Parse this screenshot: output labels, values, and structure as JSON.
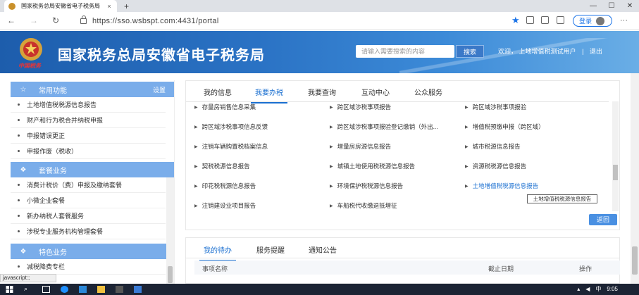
{
  "browser": {
    "tab_title": "国家税务总局安徽省电子税务局",
    "tab_close": "×",
    "new_tab": "+",
    "url": "https://sso.wsbspt.com:4431/portal",
    "login_label": "登录",
    "win_min": "—",
    "win_max": "☐",
    "win_close": "✕"
  },
  "header": {
    "title": "国家税务总局安徽省电子税务局",
    "emblem_caption": "中国税务",
    "search_placeholder": "请输入需要搜索的内容",
    "search_button": "搜索",
    "welcome": "欢迎，",
    "user": "上地增值税测试用户",
    "logout": "退出"
  },
  "sidebar": {
    "section_common": "常用功能",
    "settings": "设置",
    "common_items": [
      "土地增值税税源信息报告",
      "财产和行为税合并纳税申报",
      "申报错误更正",
      "申报作废（税收）"
    ],
    "section_package": "套餐业务",
    "package_items": [
      "消费计税价（费）申报及缴纳套餐",
      "小微企业套餐",
      "新办纳税人套餐服务",
      "涉税专业服务机构管理套餐"
    ],
    "section_special": "特色业务",
    "special_items": [
      "减税降费专栏"
    ]
  },
  "main": {
    "tabs": [
      "我的信息",
      "我要办税",
      "我要查询",
      "互动中心",
      "公众服务"
    ],
    "active_tab": "我要办税",
    "grid": [
      [
        "存量房销售信息采集",
        "跨区域涉税事项报告",
        "跨区域涉税事项报验"
      ],
      [
        "跨区域涉税事项信息反馈",
        "跨区域涉税事项报验登记缴销（外出...",
        "增值税预缴申报（跨区域）"
      ],
      [
        "注销车辆购置税档案信息",
        "增量房房源信息报告",
        "城市税源信息报告"
      ],
      [
        "契税税源信息报告",
        "城镇土地使用税税源信息报告",
        "资源税税源信息报告"
      ],
      [
        "印花税税源信息报告",
        "环境保护税税源信息报告",
        "土地增值税税源信息报告"
      ],
      [
        "注销建设业项目报告",
        "车船税代收缴退抵增征",
        ""
      ]
    ],
    "tooltip": "土地增值税税源信息报告",
    "back_button": "返回"
  },
  "todo": {
    "tabs": [
      "我的待办",
      "服务提醒",
      "通知公告"
    ],
    "active_tab": "我的待办",
    "columns": [
      "事项名称",
      "截止日期",
      "操作"
    ]
  },
  "status_text": "javascript:;",
  "taskbar": {
    "time": "9:05",
    "ime": "中"
  }
}
